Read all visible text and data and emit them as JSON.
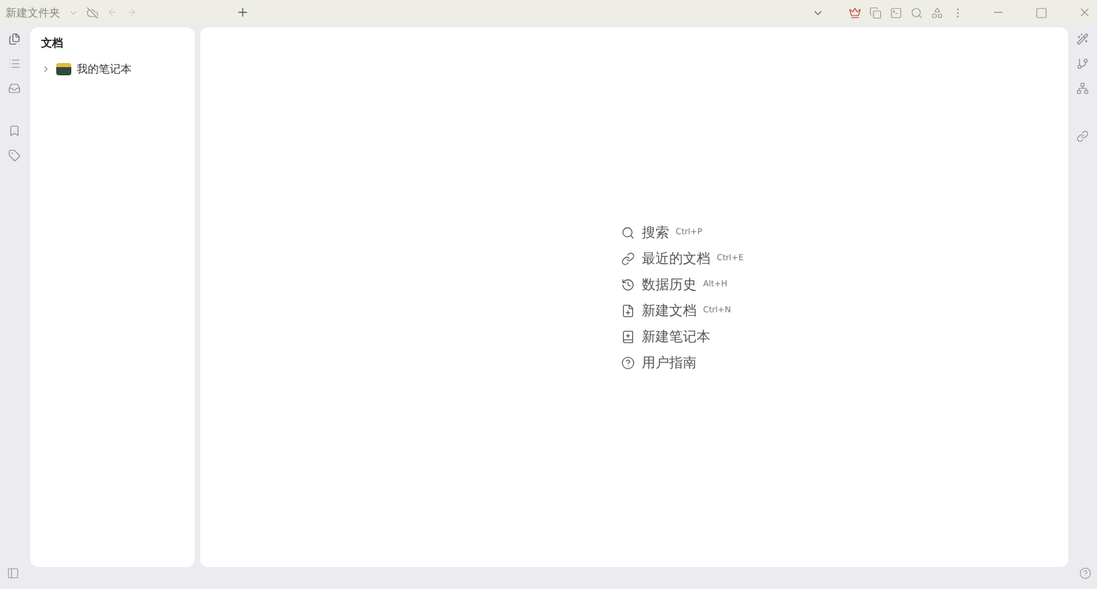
{
  "window": {
    "title": "新建文件夹"
  },
  "panel": {
    "title": "文档",
    "items": [
      {
        "label": "我的笔记本",
        "expanded": false
      }
    ]
  },
  "actions": [
    {
      "kind": "search",
      "label": "搜索",
      "shortcut": "Ctrl+P"
    },
    {
      "kind": "recent",
      "label": "最近的文档",
      "shortcut": "Ctrl+E"
    },
    {
      "kind": "history",
      "label": "数据历史",
      "shortcut": "Alt+H"
    },
    {
      "kind": "newdoc",
      "label": "新建文档",
      "shortcut": "Ctrl+N"
    },
    {
      "kind": "newbook",
      "label": "新建笔记本"
    },
    {
      "kind": "help",
      "label": "用户指南"
    }
  ]
}
